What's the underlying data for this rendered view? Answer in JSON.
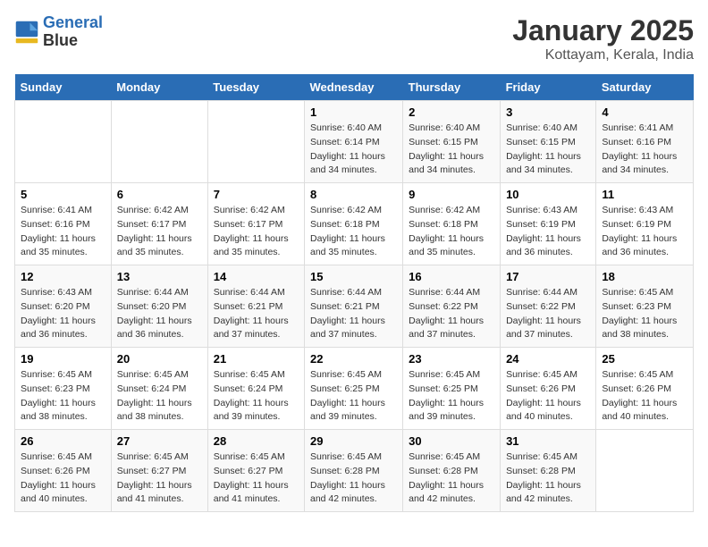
{
  "header": {
    "logo_line1": "General",
    "logo_line2": "Blue",
    "title": "January 2025",
    "subtitle": "Kottayam, Kerala, India"
  },
  "days_of_week": [
    "Sunday",
    "Monday",
    "Tuesday",
    "Wednesday",
    "Thursday",
    "Friday",
    "Saturday"
  ],
  "weeks": [
    [
      {
        "day": "",
        "info": ""
      },
      {
        "day": "",
        "info": ""
      },
      {
        "day": "",
        "info": ""
      },
      {
        "day": "1",
        "info": "Sunrise: 6:40 AM\nSunset: 6:14 PM\nDaylight: 11 hours and 34 minutes."
      },
      {
        "day": "2",
        "info": "Sunrise: 6:40 AM\nSunset: 6:15 PM\nDaylight: 11 hours and 34 minutes."
      },
      {
        "day": "3",
        "info": "Sunrise: 6:40 AM\nSunset: 6:15 PM\nDaylight: 11 hours and 34 minutes."
      },
      {
        "day": "4",
        "info": "Sunrise: 6:41 AM\nSunset: 6:16 PM\nDaylight: 11 hours and 34 minutes."
      }
    ],
    [
      {
        "day": "5",
        "info": "Sunrise: 6:41 AM\nSunset: 6:16 PM\nDaylight: 11 hours and 35 minutes."
      },
      {
        "day": "6",
        "info": "Sunrise: 6:42 AM\nSunset: 6:17 PM\nDaylight: 11 hours and 35 minutes."
      },
      {
        "day": "7",
        "info": "Sunrise: 6:42 AM\nSunset: 6:17 PM\nDaylight: 11 hours and 35 minutes."
      },
      {
        "day": "8",
        "info": "Sunrise: 6:42 AM\nSunset: 6:18 PM\nDaylight: 11 hours and 35 minutes."
      },
      {
        "day": "9",
        "info": "Sunrise: 6:42 AM\nSunset: 6:18 PM\nDaylight: 11 hours and 35 minutes."
      },
      {
        "day": "10",
        "info": "Sunrise: 6:43 AM\nSunset: 6:19 PM\nDaylight: 11 hours and 36 minutes."
      },
      {
        "day": "11",
        "info": "Sunrise: 6:43 AM\nSunset: 6:19 PM\nDaylight: 11 hours and 36 minutes."
      }
    ],
    [
      {
        "day": "12",
        "info": "Sunrise: 6:43 AM\nSunset: 6:20 PM\nDaylight: 11 hours and 36 minutes."
      },
      {
        "day": "13",
        "info": "Sunrise: 6:44 AM\nSunset: 6:20 PM\nDaylight: 11 hours and 36 minutes."
      },
      {
        "day": "14",
        "info": "Sunrise: 6:44 AM\nSunset: 6:21 PM\nDaylight: 11 hours and 37 minutes."
      },
      {
        "day": "15",
        "info": "Sunrise: 6:44 AM\nSunset: 6:21 PM\nDaylight: 11 hours and 37 minutes."
      },
      {
        "day": "16",
        "info": "Sunrise: 6:44 AM\nSunset: 6:22 PM\nDaylight: 11 hours and 37 minutes."
      },
      {
        "day": "17",
        "info": "Sunrise: 6:44 AM\nSunset: 6:22 PM\nDaylight: 11 hours and 37 minutes."
      },
      {
        "day": "18",
        "info": "Sunrise: 6:45 AM\nSunset: 6:23 PM\nDaylight: 11 hours and 38 minutes."
      }
    ],
    [
      {
        "day": "19",
        "info": "Sunrise: 6:45 AM\nSunset: 6:23 PM\nDaylight: 11 hours and 38 minutes."
      },
      {
        "day": "20",
        "info": "Sunrise: 6:45 AM\nSunset: 6:24 PM\nDaylight: 11 hours and 38 minutes."
      },
      {
        "day": "21",
        "info": "Sunrise: 6:45 AM\nSunset: 6:24 PM\nDaylight: 11 hours and 39 minutes."
      },
      {
        "day": "22",
        "info": "Sunrise: 6:45 AM\nSunset: 6:25 PM\nDaylight: 11 hours and 39 minutes."
      },
      {
        "day": "23",
        "info": "Sunrise: 6:45 AM\nSunset: 6:25 PM\nDaylight: 11 hours and 39 minutes."
      },
      {
        "day": "24",
        "info": "Sunrise: 6:45 AM\nSunset: 6:26 PM\nDaylight: 11 hours and 40 minutes."
      },
      {
        "day": "25",
        "info": "Sunrise: 6:45 AM\nSunset: 6:26 PM\nDaylight: 11 hours and 40 minutes."
      }
    ],
    [
      {
        "day": "26",
        "info": "Sunrise: 6:45 AM\nSunset: 6:26 PM\nDaylight: 11 hours and 40 minutes."
      },
      {
        "day": "27",
        "info": "Sunrise: 6:45 AM\nSunset: 6:27 PM\nDaylight: 11 hours and 41 minutes."
      },
      {
        "day": "28",
        "info": "Sunrise: 6:45 AM\nSunset: 6:27 PM\nDaylight: 11 hours and 41 minutes."
      },
      {
        "day": "29",
        "info": "Sunrise: 6:45 AM\nSunset: 6:28 PM\nDaylight: 11 hours and 42 minutes."
      },
      {
        "day": "30",
        "info": "Sunrise: 6:45 AM\nSunset: 6:28 PM\nDaylight: 11 hours and 42 minutes."
      },
      {
        "day": "31",
        "info": "Sunrise: 6:45 AM\nSunset: 6:28 PM\nDaylight: 11 hours and 42 minutes."
      },
      {
        "day": "",
        "info": ""
      }
    ]
  ]
}
